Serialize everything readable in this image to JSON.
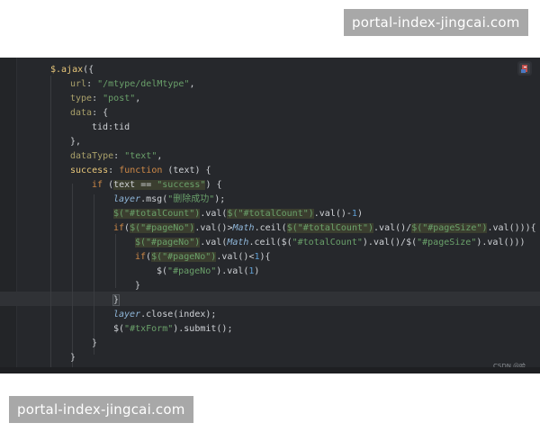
{
  "watermark": {
    "top": "portal-index-jingcai.com",
    "bottom": "portal-index-jingcai.com"
  },
  "editor": {
    "credit": "CSDN @哈__",
    "icon": "plugin-icon",
    "colors": {
      "background": "#26282c",
      "keyword": "#d08a48",
      "string": "#6aa06a",
      "number": "#5f9fd4"
    }
  },
  "code": {
    "l1": {
      "call": "$.ajax",
      "open": "({"
    },
    "l2": {
      "key": "url",
      "colon": ": ",
      "value": "\"/mtype/delMtype\"",
      "comma": ","
    },
    "l3": {
      "key": "type",
      "colon": ": ",
      "value": "\"post\"",
      "comma": ","
    },
    "l4": {
      "key": "data",
      "colon": ": ",
      "open": "{"
    },
    "l5": {
      "text": "tid:tid"
    },
    "l6": {
      "text": "},"
    },
    "l7": {
      "key": "dataType",
      "colon": ": ",
      "value": "\"text\"",
      "comma": ","
    },
    "l8": {
      "key": "success",
      "colon": ": ",
      "kw": "function",
      "params": " (text) {"
    },
    "l9": {
      "kw": "if",
      "open": " (",
      "cond": "text == ",
      "value": "\"success\"",
      "close": ") {"
    },
    "l10": {
      "obj": "layer",
      "method": ".msg(",
      "value": "\"删除成功\"",
      "close": ");"
    },
    "l11": {
      "sel1": "$(\"#totalCount\")",
      "mid1": ".val(",
      "sel2": "$(\"#totalCount\")",
      "mid2": ".val()-",
      "num": "1",
      "close": ")"
    },
    "l12": {
      "kw": "if",
      "open": "(",
      "sel1": "$(\"#pageNo\")",
      "mid1": ".val()>",
      "math": "Math",
      "ceil": ".ceil(",
      "sel2": "$(\"#totalCount\")",
      "mid2": ".val()/",
      "sel3": "$(\"#pageSize\")",
      "close": ".val())){"
    },
    "l13": {
      "sel1": "$(\"#pageNo\")",
      "mid1": ".val(",
      "math": "Math",
      "ceil": ".ceil($(",
      "str1": "\"#totalCount\"",
      "mid2": ").val()/$(",
      "str2": "\"#pageSize\"",
      "close": ").val()))"
    },
    "l14": {
      "kw": "if",
      "open": "(",
      "sel1": "$(\"#pageNo\")",
      "mid1": ".val()<",
      "num": "1",
      "close": "){"
    },
    "l15": {
      "open": "$(",
      "str1": "\"#pageNo\"",
      "mid1": ").val(",
      "num": "1",
      "close": ")"
    },
    "l16": {
      "text": "}"
    },
    "l17": {
      "text": "}"
    },
    "l18": {
      "obj": "layer",
      "method": ".close(index);"
    },
    "l19": {
      "open": "$(",
      "str1": "\"#txForm\"",
      "close": ").submit();"
    },
    "l20": {
      "text": "}"
    },
    "l21": {
      "text": "}"
    }
  }
}
